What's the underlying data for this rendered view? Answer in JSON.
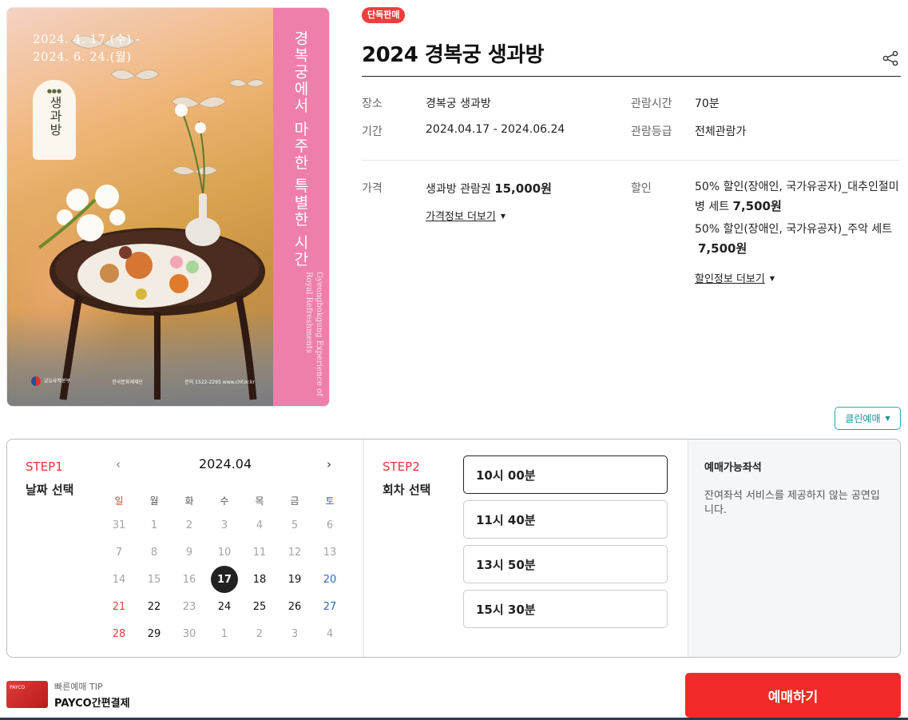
{
  "poster": {
    "dates": [
      "2024. 4. 17.(수) -",
      "2024. 6. 24.(월)"
    ],
    "logo_text": "생과방",
    "vertical_title": "경복궁에서 마주한 특별한 시간",
    "vertical_subtitle": "Gyeongbokgung Experience of Royal Refreshments",
    "footer_left": "궁능유적본부",
    "footer_mid": "한국문화재재단",
    "footer_right": "문의 1522-2295 www.chf.or.kr"
  },
  "badge": "단독판매",
  "title": "2024 경복궁 생과방",
  "info": {
    "venue_label": "장소",
    "venue": "경복궁 생과방",
    "period_label": "기간",
    "period": "2024.04.17 - 2024.06.24",
    "runtime_label": "관람시간",
    "runtime": "70분",
    "rating_label": "관람등급",
    "rating": "전체관람가",
    "price_label": "가격",
    "price_item": "생과방 관람권",
    "price_value": "15,000원",
    "price_more": "가격정보 더보기",
    "discount_label": "할인",
    "discount1_text": "50% 할인(장애인, 국가유공자)_대추인절미병 세트",
    "discount1_price": "7,500원",
    "discount2_text": "50% 할인(장애인, 국가유공자)_주악 세트",
    "discount2_price": "7,500원",
    "discount_more": "할인정보 더보기"
  },
  "clean_booking": "클린예매",
  "step1": {
    "label": "STEP1",
    "title": "날짜 선택",
    "month": "2024.04",
    "prev": "‹",
    "next": "›",
    "weekdays": [
      "일",
      "월",
      "화",
      "수",
      "목",
      "금",
      "토"
    ],
    "weeks": [
      [
        "31",
        "1",
        "2",
        "3",
        "4",
        "5",
        "6"
      ],
      [
        "7",
        "8",
        "9",
        "10",
        "11",
        "12",
        "13"
      ],
      [
        "14",
        "15",
        "16",
        "17",
        "18",
        "19",
        "20"
      ],
      [
        "21",
        "22",
        "23",
        "24",
        "25",
        "26",
        "27"
      ],
      [
        "28",
        "29",
        "30",
        "1",
        "2",
        "3",
        "4"
      ]
    ],
    "selected": "17"
  },
  "step2": {
    "label": "STEP2",
    "title": "회차 선택",
    "times": [
      "10시 00분",
      "11시 40분",
      "13시 50분",
      "15시 30분"
    ]
  },
  "seats": {
    "title": "예매가능좌석",
    "desc": "잔여좌석 서비스를 제공하지 않는 공연입니다."
  },
  "footer": {
    "tip": "빠른예매 TIP",
    "payco": "PAYCO간편결제",
    "card_label": "PAYCO",
    "book": "예매하기"
  },
  "colors": {
    "accent_red": "#f42a2a",
    "step_red": "#e8343a",
    "teal": "#2aa8b0",
    "poster_pink": "#ee7fab"
  }
}
